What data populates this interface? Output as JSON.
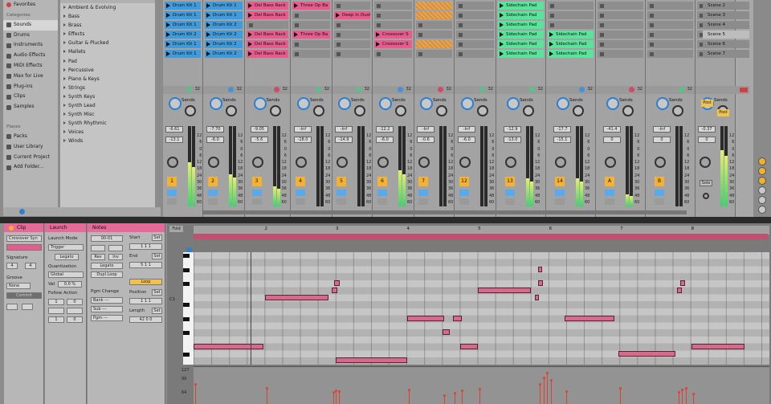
{
  "browser": {
    "places": [
      {
        "label": "Favorites",
        "icon": "heart-icon",
        "head": false
      },
      {
        "label": "Categories",
        "head": true
      },
      {
        "label": "Sounds",
        "icon": "sound-icon",
        "sel": true
      },
      {
        "label": "Drums",
        "icon": "drum-icon"
      },
      {
        "label": "Instruments",
        "icon": "keyboard-icon"
      },
      {
        "label": "Audio Effects",
        "icon": "audio-effect-icon"
      },
      {
        "label": "MIDI Effects",
        "icon": "midi-effect-icon"
      },
      {
        "label": "Max for Live",
        "icon": "max-icon"
      },
      {
        "label": "Plug-ins",
        "icon": "plugin-icon"
      },
      {
        "label": "Clips",
        "icon": "clip-icon"
      },
      {
        "label": "Samples",
        "icon": "sample-icon"
      },
      {
        "label": "",
        "head": true
      },
      {
        "label": "Places",
        "head": true
      },
      {
        "label": "Packs",
        "icon": "pack-icon"
      },
      {
        "label": "User Library",
        "icon": "folder-icon"
      },
      {
        "label": "Current Project",
        "icon": "folder-icon"
      },
      {
        "label": "Add Folder...",
        "icon": "add-icon"
      }
    ],
    "files": [
      "Ambient & Evolving",
      "Bass",
      "Brass",
      "Effects",
      "Guitar & Plucked",
      "Mallets",
      "Pad",
      "Percussive",
      "Piano & Keys",
      "Strings",
      "Synth Keys",
      "Synth Lead",
      "Synth Misc",
      "Synth Rhythmic",
      "Voices",
      "Winds"
    ]
  },
  "session": {
    "tracks": [
      {
        "clips": [
          [
            "blue",
            "Drum Kit 1"
          ],
          [
            "blue",
            "Drum Kit 1"
          ],
          [
            "blue",
            "Drum Kit 1"
          ],
          [
            "blue",
            "Drum Kit 2"
          ],
          [
            "blue",
            "Drum Kit 1"
          ],
          [
            "blue",
            "Drum Kit 1"
          ]
        ],
        "vol": "-6.61",
        "pan": "-13.1",
        "num": "1",
        "level": 0.55
      },
      {
        "clips": [
          [
            "blue",
            "Drum Kit 1"
          ],
          [
            "blue",
            "Drum Kit 1"
          ],
          [
            "blue",
            "Drum Kit 2"
          ],
          [
            "blue",
            "Drum Kit 2"
          ],
          [
            "blue",
            "Drum Kit 2"
          ],
          [
            "blue",
            "Drum Kit 2"
          ]
        ],
        "vol": "-7.70",
        "pan": "-6.0",
        "num": "2",
        "level": 0.4
      },
      {
        "clips": [
          [
            "pink",
            "Del Bass Rack"
          ],
          [
            "pink",
            "Del Bass Rack"
          ],
          [
            "empty",
            ""
          ],
          [
            "pink",
            "Del Bass Rack"
          ],
          [
            "pink",
            "Del Bass Rack"
          ],
          [
            "pink",
            "Del Bass Rack"
          ]
        ],
        "vol": "-9.05",
        "pan": "-5.6",
        "num": "3",
        "level": 0.25
      },
      {
        "clips": [
          [
            "pink",
            "Three Op Ba"
          ],
          [
            "empty",
            ""
          ],
          [
            "empty",
            ""
          ],
          [
            "pink",
            "Three Op Ba"
          ],
          [
            "empty",
            ""
          ],
          [
            "empty",
            ""
          ]
        ],
        "vol": "-Inf",
        "pan": "-18.0",
        "num": "4",
        "level": 0.0
      },
      {
        "clips": [
          [
            "empty",
            ""
          ],
          [
            "pink",
            "Deep in Dust"
          ],
          [
            "empty",
            ""
          ],
          [
            "empty",
            ""
          ],
          [
            "empty",
            ""
          ],
          [
            "empty",
            ""
          ]
        ],
        "vol": "-Inf",
        "pan": "-14.9",
        "num": "5",
        "level": 0.0
      },
      {
        "clips": [
          [
            "empty",
            ""
          ],
          [
            "empty",
            ""
          ],
          [
            "empty",
            ""
          ],
          [
            "pink",
            "Crossover S"
          ],
          [
            "pink",
            "Crossover S"
          ],
          [
            "empty",
            ""
          ]
        ],
        "vol": "-12.2",
        "pan": "-6.0",
        "num": "6",
        "level": 0.45
      },
      {
        "clips": [
          [
            "stripe",
            ""
          ],
          [
            "stripe",
            ""
          ],
          [
            "empty",
            ""
          ],
          [
            "empty",
            ""
          ],
          [
            "stripe",
            ""
          ],
          [
            "empty",
            ""
          ]
        ],
        "vol": "-Inf",
        "pan": "-0.6",
        "num": "7",
        "level": 0.0
      },
      {
        "clips": [
          [
            "empty",
            ""
          ],
          [
            "empty",
            ""
          ],
          [
            "empty",
            ""
          ],
          [
            "empty",
            ""
          ],
          [
            "empty",
            ""
          ],
          [
            "empty",
            ""
          ]
        ],
        "vol": "-Inf",
        "pan": "-6.0",
        "num": "12",
        "level": 0.0
      },
      {
        "clips": [
          [
            "green",
            "Sidechain Pad"
          ],
          [
            "green",
            "Sidechain Pad"
          ],
          [
            "green",
            "Sidechain Pad"
          ],
          [
            "green",
            "Sidechain Pad"
          ],
          [
            "green",
            "Sidechain Pad"
          ],
          [
            "green",
            "Sidechain Pad"
          ]
        ],
        "vol": "-12.9",
        "pan": "-13.0",
        "num": "13",
        "level": 0.35
      },
      {
        "clips": [
          [
            "empty",
            ""
          ],
          [
            "empty",
            ""
          ],
          [
            "empty",
            ""
          ],
          [
            "green",
            "Sidechain Pad"
          ],
          [
            "green",
            "Sidechain Pad"
          ],
          [
            "green",
            "Sidechain Pad"
          ]
        ],
        "vol": "-17.7",
        "pan": "-15.1",
        "num": "14",
        "level": 0.35
      },
      {
        "clips": [
          [
            "empty",
            ""
          ],
          [
            "empty",
            ""
          ],
          [
            "empty",
            ""
          ],
          [
            "empty",
            ""
          ],
          [
            "empty",
            ""
          ],
          [
            "empty",
            ""
          ]
        ],
        "vol": "-41.4",
        "pan": "0",
        "num": "A",
        "level": 0.15
      },
      {
        "clips": [
          [
            "empty",
            ""
          ],
          [
            "empty",
            ""
          ],
          [
            "empty",
            ""
          ],
          [
            "empty",
            ""
          ],
          [
            "empty",
            ""
          ],
          [
            "empty",
            ""
          ]
        ],
        "vol": "-Inf",
        "pan": "0",
        "num": "B",
        "level": 0.0
      },
      {
        "clips": [
          [
            "empty",
            ""
          ],
          [
            "empty",
            ""
          ],
          [
            "empty",
            ""
          ],
          [
            "empty",
            ""
          ],
          [
            "empty",
            ""
          ],
          [
            "empty",
            ""
          ]
        ],
        "vol": "-0.37",
        "pan": "0",
        "num": "",
        "level": 0.7
      }
    ],
    "scenes": [
      "Scene 2",
      "Scene 3",
      "Scene 4",
      "Scene 5",
      "Scene 6",
      "Scene 7"
    ],
    "sends_label": "Sends",
    "io_value": "32",
    "post_label": "Post",
    "scale": [
      "12",
      "6",
      "0",
      "6",
      "12",
      "18",
      "24",
      "30",
      "36",
      "48",
      "60"
    ],
    "solo_label": "Solo"
  },
  "clip_panel": {
    "header": "Clip",
    "name": "Crossover Syn",
    "signature_label": "Signature",
    "sig_num": "4",
    "sig_den": "4",
    "groove_label": "Groove",
    "groove_value": "None",
    "commit_label": "Commit"
  },
  "launch_panel": {
    "header": "Launch",
    "mode_label": "Launch Mode",
    "mode_value": "Trigger",
    "legato": "Legato",
    "quant_label": "Quantization",
    "quant_value": "Global",
    "vel_label": "Vel",
    "vel_value": "0.0 %",
    "follow_label": "Follow Action",
    "f1": "1",
    "f2": "0",
    "f3": "1",
    "f4": "0"
  },
  "notes_panel": {
    "header": "Notes",
    "transpose": "00-01",
    "rev": "Rev",
    "inv": "Inv",
    "legato": "Legato",
    "dupl": "Dupl.Loop",
    "pgm_label": "Pgm Change",
    "bank": "Bank ---",
    "sub": "Sub ---",
    "pgm": "Pgm ---",
    "start_label": "Start",
    "start": "1  1  1",
    "end_label": "End",
    "end": "5  1  1",
    "loop_label": "Loop",
    "pos_label": "Position",
    "pos": "1  1  1",
    "len_label": "Length",
    "len": "42  0  0",
    "set": "Set"
  },
  "piano_roll": {
    "fold": "Fold",
    "bars": [
      "2",
      "3",
      "4",
      "5",
      "6",
      "7",
      "8"
    ],
    "c1_label": "C1",
    "vel_top": "127",
    "vel_mid1": "99",
    "vel_mid2": "64",
    "vel_max": 127,
    "notes": [
      {
        "bar": 0.0,
        "len": 0.98,
        "row": 13
      },
      {
        "bar": 1.0,
        "len": 0.9,
        "row": 6
      },
      {
        "bar": 2.0,
        "len": 1.0,
        "row": 15
      },
      {
        "bar": 1.98,
        "len": 0.08,
        "row": 4
      },
      {
        "bar": 1.94,
        "len": 0.08,
        "row": 5
      },
      {
        "bar": 3.0,
        "len": 0.52,
        "row": 9
      },
      {
        "bar": 3.5,
        "len": 0.1,
        "row": 11
      },
      {
        "bar": 3.65,
        "len": 0.12,
        "row": 9
      },
      {
        "bar": 3.75,
        "len": 0.25,
        "row": 13
      },
      {
        "bar": 4.0,
        "len": 0.75,
        "row": 5
      },
      {
        "bar": 4.8,
        "len": 0.06,
        "row": 6
      },
      {
        "bar": 4.85,
        "len": 0.06,
        "row": 4
      },
      {
        "bar": 4.85,
        "len": 0.05,
        "row": 2
      },
      {
        "bar": 5.22,
        "len": 0.7,
        "row": 9
      },
      {
        "bar": 5.98,
        "len": 0.8,
        "row": 14
      },
      {
        "bar": 6.8,
        "len": 0.07,
        "row": 5
      },
      {
        "bar": 6.85,
        "len": 0.06,
        "row": 4
      },
      {
        "bar": 7.0,
        "len": 0.75,
        "row": 13
      }
    ],
    "velocities": [
      {
        "pos": 0.0,
        "v": 70
      },
      {
        "pos": 1.0,
        "v": 55
      },
      {
        "pos": 1.94,
        "v": 40
      },
      {
        "pos": 1.98,
        "v": 45
      },
      {
        "pos": 2.02,
        "v": 42
      },
      {
        "pos": 3.0,
        "v": 50
      },
      {
        "pos": 3.5,
        "v": 30
      },
      {
        "pos": 3.65,
        "v": 38
      },
      {
        "pos": 3.75,
        "v": 45
      },
      {
        "pos": 4.0,
        "v": 52
      },
      {
        "pos": 4.85,
        "v": 70
      },
      {
        "pos": 4.9,
        "v": 92
      },
      {
        "pos": 4.95,
        "v": 110
      },
      {
        "pos": 5.0,
        "v": 85
      },
      {
        "pos": 5.22,
        "v": 44
      },
      {
        "pos": 5.98,
        "v": 55
      },
      {
        "pos": 6.8,
        "v": 40
      },
      {
        "pos": 6.85,
        "v": 48
      },
      {
        "pos": 6.9,
        "v": 55
      },
      {
        "pos": 7.0,
        "v": 35
      }
    ]
  },
  "right_side": {
    "buttons": 4
  }
}
